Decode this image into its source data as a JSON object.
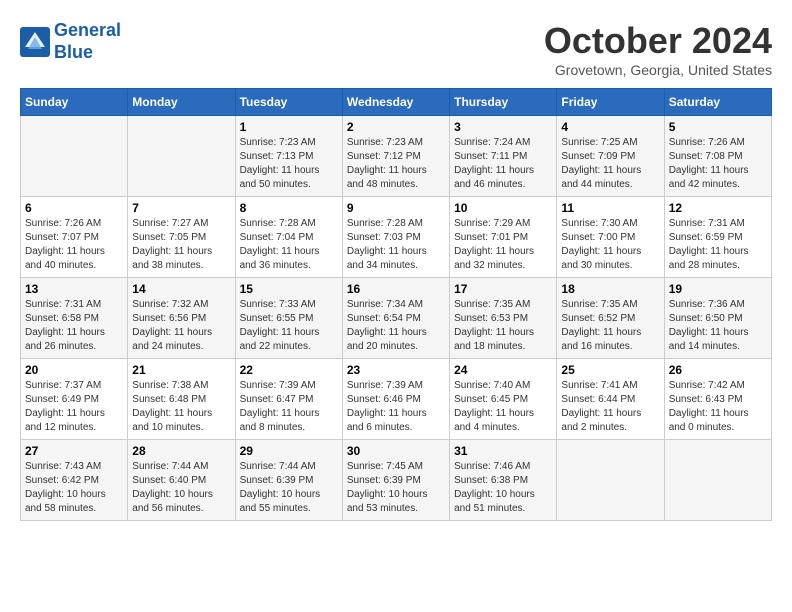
{
  "header": {
    "logo_line1": "General",
    "logo_line2": "Blue",
    "month_title": "October 2024",
    "location": "Grovetown, Georgia, United States"
  },
  "weekdays": [
    "Sunday",
    "Monday",
    "Tuesday",
    "Wednesday",
    "Thursday",
    "Friday",
    "Saturday"
  ],
  "weeks": [
    [
      {
        "day": "",
        "sunrise": "",
        "sunset": "",
        "daylight": ""
      },
      {
        "day": "",
        "sunrise": "",
        "sunset": "",
        "daylight": ""
      },
      {
        "day": "1",
        "sunrise": "Sunrise: 7:23 AM",
        "sunset": "Sunset: 7:13 PM",
        "daylight": "Daylight: 11 hours and 50 minutes."
      },
      {
        "day": "2",
        "sunrise": "Sunrise: 7:23 AM",
        "sunset": "Sunset: 7:12 PM",
        "daylight": "Daylight: 11 hours and 48 minutes."
      },
      {
        "day": "3",
        "sunrise": "Sunrise: 7:24 AM",
        "sunset": "Sunset: 7:11 PM",
        "daylight": "Daylight: 11 hours and 46 minutes."
      },
      {
        "day": "4",
        "sunrise": "Sunrise: 7:25 AM",
        "sunset": "Sunset: 7:09 PM",
        "daylight": "Daylight: 11 hours and 44 minutes."
      },
      {
        "day": "5",
        "sunrise": "Sunrise: 7:26 AM",
        "sunset": "Sunset: 7:08 PM",
        "daylight": "Daylight: 11 hours and 42 minutes."
      }
    ],
    [
      {
        "day": "6",
        "sunrise": "Sunrise: 7:26 AM",
        "sunset": "Sunset: 7:07 PM",
        "daylight": "Daylight: 11 hours and 40 minutes."
      },
      {
        "day": "7",
        "sunrise": "Sunrise: 7:27 AM",
        "sunset": "Sunset: 7:05 PM",
        "daylight": "Daylight: 11 hours and 38 minutes."
      },
      {
        "day": "8",
        "sunrise": "Sunrise: 7:28 AM",
        "sunset": "Sunset: 7:04 PM",
        "daylight": "Daylight: 11 hours and 36 minutes."
      },
      {
        "day": "9",
        "sunrise": "Sunrise: 7:28 AM",
        "sunset": "Sunset: 7:03 PM",
        "daylight": "Daylight: 11 hours and 34 minutes."
      },
      {
        "day": "10",
        "sunrise": "Sunrise: 7:29 AM",
        "sunset": "Sunset: 7:01 PM",
        "daylight": "Daylight: 11 hours and 32 minutes."
      },
      {
        "day": "11",
        "sunrise": "Sunrise: 7:30 AM",
        "sunset": "Sunset: 7:00 PM",
        "daylight": "Daylight: 11 hours and 30 minutes."
      },
      {
        "day": "12",
        "sunrise": "Sunrise: 7:31 AM",
        "sunset": "Sunset: 6:59 PM",
        "daylight": "Daylight: 11 hours and 28 minutes."
      }
    ],
    [
      {
        "day": "13",
        "sunrise": "Sunrise: 7:31 AM",
        "sunset": "Sunset: 6:58 PM",
        "daylight": "Daylight: 11 hours and 26 minutes."
      },
      {
        "day": "14",
        "sunrise": "Sunrise: 7:32 AM",
        "sunset": "Sunset: 6:56 PM",
        "daylight": "Daylight: 11 hours and 24 minutes."
      },
      {
        "day": "15",
        "sunrise": "Sunrise: 7:33 AM",
        "sunset": "Sunset: 6:55 PM",
        "daylight": "Daylight: 11 hours and 22 minutes."
      },
      {
        "day": "16",
        "sunrise": "Sunrise: 7:34 AM",
        "sunset": "Sunset: 6:54 PM",
        "daylight": "Daylight: 11 hours and 20 minutes."
      },
      {
        "day": "17",
        "sunrise": "Sunrise: 7:35 AM",
        "sunset": "Sunset: 6:53 PM",
        "daylight": "Daylight: 11 hours and 18 minutes."
      },
      {
        "day": "18",
        "sunrise": "Sunrise: 7:35 AM",
        "sunset": "Sunset: 6:52 PM",
        "daylight": "Daylight: 11 hours and 16 minutes."
      },
      {
        "day": "19",
        "sunrise": "Sunrise: 7:36 AM",
        "sunset": "Sunset: 6:50 PM",
        "daylight": "Daylight: 11 hours and 14 minutes."
      }
    ],
    [
      {
        "day": "20",
        "sunrise": "Sunrise: 7:37 AM",
        "sunset": "Sunset: 6:49 PM",
        "daylight": "Daylight: 11 hours and 12 minutes."
      },
      {
        "day": "21",
        "sunrise": "Sunrise: 7:38 AM",
        "sunset": "Sunset: 6:48 PM",
        "daylight": "Daylight: 11 hours and 10 minutes."
      },
      {
        "day": "22",
        "sunrise": "Sunrise: 7:39 AM",
        "sunset": "Sunset: 6:47 PM",
        "daylight": "Daylight: 11 hours and 8 minutes."
      },
      {
        "day": "23",
        "sunrise": "Sunrise: 7:39 AM",
        "sunset": "Sunset: 6:46 PM",
        "daylight": "Daylight: 11 hours and 6 minutes."
      },
      {
        "day": "24",
        "sunrise": "Sunrise: 7:40 AM",
        "sunset": "Sunset: 6:45 PM",
        "daylight": "Daylight: 11 hours and 4 minutes."
      },
      {
        "day": "25",
        "sunrise": "Sunrise: 7:41 AM",
        "sunset": "Sunset: 6:44 PM",
        "daylight": "Daylight: 11 hours and 2 minutes."
      },
      {
        "day": "26",
        "sunrise": "Sunrise: 7:42 AM",
        "sunset": "Sunset: 6:43 PM",
        "daylight": "Daylight: 11 hours and 0 minutes."
      }
    ],
    [
      {
        "day": "27",
        "sunrise": "Sunrise: 7:43 AM",
        "sunset": "Sunset: 6:42 PM",
        "daylight": "Daylight: 10 hours and 58 minutes."
      },
      {
        "day": "28",
        "sunrise": "Sunrise: 7:44 AM",
        "sunset": "Sunset: 6:40 PM",
        "daylight": "Daylight: 10 hours and 56 minutes."
      },
      {
        "day": "29",
        "sunrise": "Sunrise: 7:44 AM",
        "sunset": "Sunset: 6:39 PM",
        "daylight": "Daylight: 10 hours and 55 minutes."
      },
      {
        "day": "30",
        "sunrise": "Sunrise: 7:45 AM",
        "sunset": "Sunset: 6:39 PM",
        "daylight": "Daylight: 10 hours and 53 minutes."
      },
      {
        "day": "31",
        "sunrise": "Sunrise: 7:46 AM",
        "sunset": "Sunset: 6:38 PM",
        "daylight": "Daylight: 10 hours and 51 minutes."
      },
      {
        "day": "",
        "sunrise": "",
        "sunset": "",
        "daylight": ""
      },
      {
        "day": "",
        "sunrise": "",
        "sunset": "",
        "daylight": ""
      }
    ]
  ]
}
